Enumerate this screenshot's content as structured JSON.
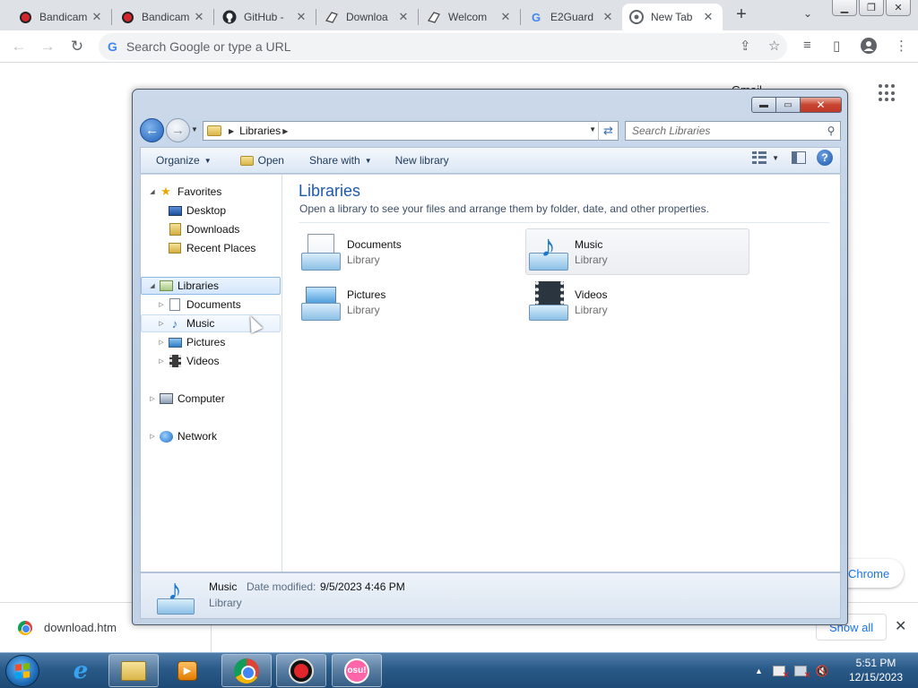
{
  "browser": {
    "tabs": [
      {
        "title": "Bandicam",
        "icon": "bandicam-record-icon",
        "active": false
      },
      {
        "title": "Bandicam",
        "icon": "bandicam-record-icon",
        "active": false
      },
      {
        "title": "GitHub -",
        "icon": "github-icon",
        "active": false
      },
      {
        "title": "Downloa",
        "icon": "document-icon",
        "active": false
      },
      {
        "title": "Welcom",
        "icon": "document-icon",
        "active": false
      },
      {
        "title": "E2Guard",
        "icon": "google-g-icon",
        "active": false
      },
      {
        "title": "New Tab",
        "icon": "chrome-icon",
        "active": true
      }
    ],
    "omnibox_placeholder": "Search Google or type a URL",
    "ntp_gmail_link": "Gmail",
    "customize_chip": "Chrome"
  },
  "download_bar": {
    "file_name": "download.htm",
    "show_all": "Show all"
  },
  "explorer": {
    "breadcrumb": "Libraries",
    "search_placeholder": "Search Libraries",
    "commands": {
      "organize": "Organize",
      "open": "Open",
      "share_with": "Share with",
      "new_library": "New library"
    },
    "nav": {
      "favorites": "Favorites",
      "desktop": "Desktop",
      "downloads": "Downloads",
      "recent_places": "Recent Places",
      "libraries": "Libraries",
      "documents": "Documents",
      "music": "Music",
      "pictures": "Pictures",
      "videos": "Videos",
      "computer": "Computer",
      "network": "Network"
    },
    "content": {
      "title": "Libraries",
      "subtitle": "Open a library to see your files and arrange them by folder, date, and other properties.",
      "items": [
        {
          "name": "Documents",
          "type": "Library"
        },
        {
          "name": "Music",
          "type": "Library"
        },
        {
          "name": "Pictures",
          "type": "Library"
        },
        {
          "name": "Videos",
          "type": "Library"
        }
      ]
    },
    "details": {
      "name": "Music",
      "modified_label": "Date modified:",
      "modified_value": "9/5/2023 4:46 PM",
      "type": "Library"
    }
  },
  "taskbar": {
    "ie_glyph": "e",
    "osu_label": "osu!",
    "time": "5:51 PM",
    "date": "12/15/2023"
  }
}
